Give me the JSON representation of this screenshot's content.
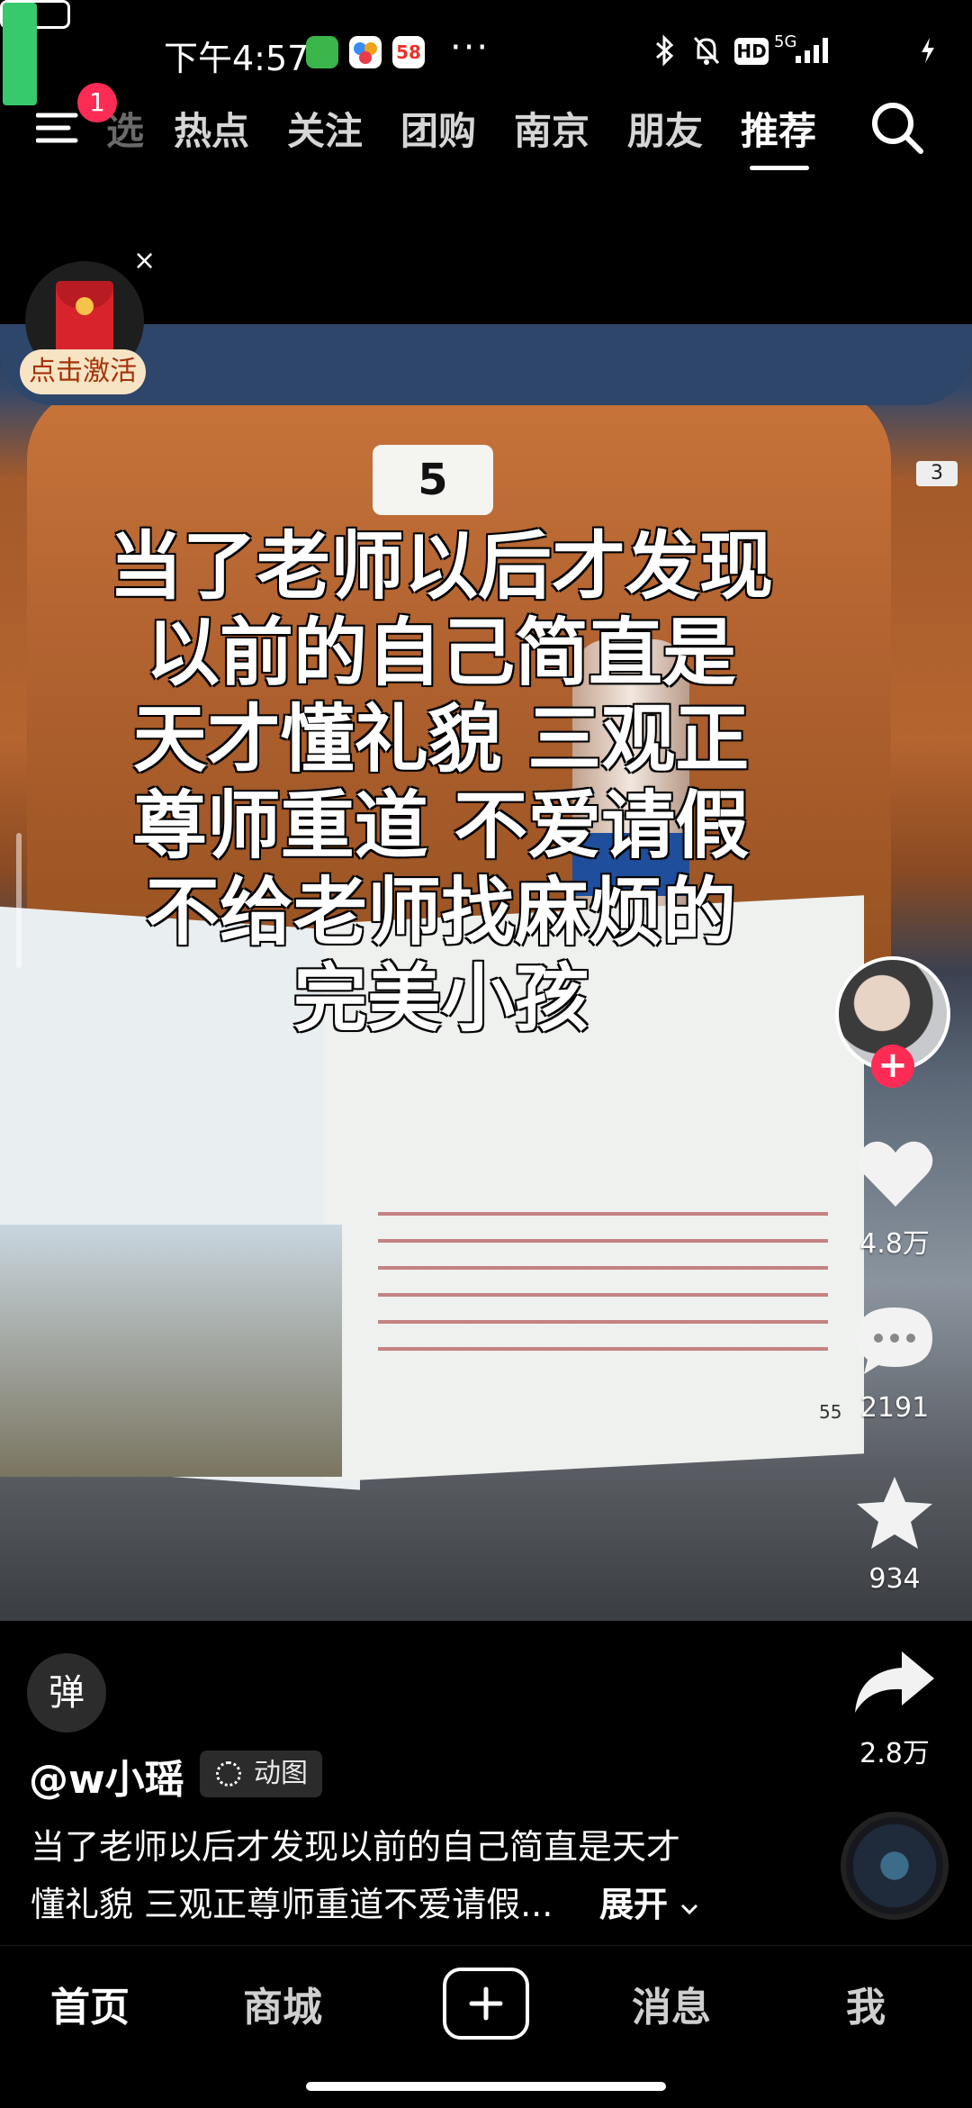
{
  "status_bar": {
    "time": "下午4:57",
    "app_58": "58",
    "dots": "···",
    "network": "5G",
    "battery_level": "57",
    "battery_fraction": 0.57
  },
  "top_nav": {
    "tabs": [
      {
        "label": "热点"
      },
      {
        "label": "关注"
      },
      {
        "label": "团购"
      },
      {
        "label": "南京"
      },
      {
        "label": "朋友"
      },
      {
        "label": "推荐"
      }
    ],
    "active_tab": "推荐",
    "menu_badge": "1",
    "hidden_tab_fragment": "选"
  },
  "red_packet": {
    "close": "×",
    "activate_label": "点击激活"
  },
  "video": {
    "seat_number": "5",
    "side_seat_number": "3",
    "page_number": "55",
    "overlay_lines": [
      "当了老师以后才发现",
      "以前的自己简直是",
      "天才懂礼貌 三观正",
      "尊师重道 不爱请假",
      "不给老师找麻烦的",
      "完美小孩"
    ]
  },
  "actions": {
    "follow": "+",
    "likes": "4.8万",
    "comments": "2191",
    "favorites": "934",
    "shares": "2.8万"
  },
  "post": {
    "danmu_label": "弹",
    "username": "@w小瑶",
    "badge": "动图",
    "caption_line1": "当了老师以后才发现以前的自己简直是天才",
    "caption_line2": "懂礼貌 三观正尊师重道不爱请假...",
    "expand_label": "展开"
  },
  "bottom_nav": {
    "home": "首页",
    "mall": "商城",
    "messages": "消息",
    "me": "我"
  },
  "colors": {
    "accent_red": "#fe2c55",
    "battery_green": "#37c96b"
  }
}
